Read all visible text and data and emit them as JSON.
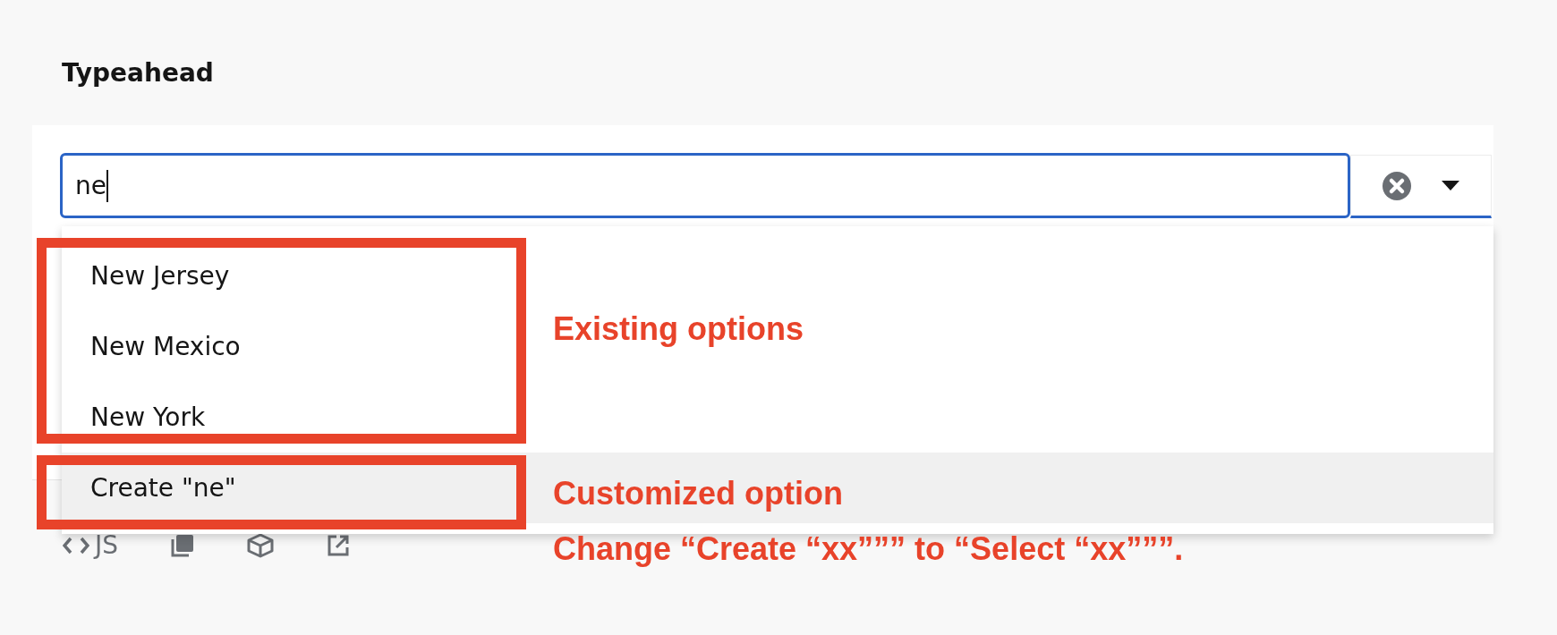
{
  "section_title": "Typeahead",
  "typeahead": {
    "value": "ne",
    "focused": true,
    "has_clear": true,
    "expanded": true,
    "options": [
      {
        "label": "New Jersey",
        "highlighted": false
      },
      {
        "label": "New Mexico",
        "highlighted": false
      },
      {
        "label": "New York",
        "highlighted": false
      },
      {
        "label": "Create \"ne\"",
        "highlighted": true
      }
    ]
  },
  "toolbar": {
    "code_label": "JS"
  },
  "annotations": [
    {
      "text": "Existing options",
      "kind": "frame-options"
    },
    {
      "text": "Customized option",
      "kind": "frame-create"
    },
    {
      "text": "Change “Create “xx””” to “Select “xx”””.",
      "kind": "note"
    }
  ]
}
